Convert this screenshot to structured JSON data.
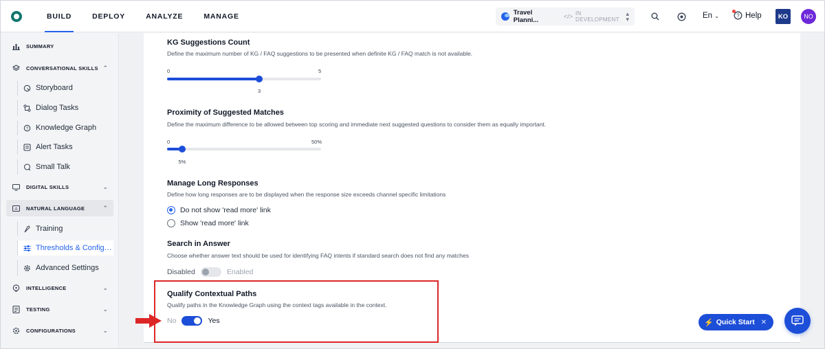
{
  "topbar": {
    "tabs": [
      "BUILD",
      "DEPLOY",
      "ANALYZE",
      "MANAGE"
    ],
    "active_tab": "BUILD",
    "app_name": "Travel Planni...",
    "app_status": "IN DEVELOPMENT",
    "language": "En",
    "help_label": "Help",
    "user_initials": "KO",
    "account_initials": "NO"
  },
  "sidebar": {
    "summary": "SUMMARY",
    "conversational_skills": "CONVERSATIONAL SKILLS",
    "conversational_items": [
      "Storyboard",
      "Dialog Tasks",
      "Knowledge Graph",
      "Alert Tasks",
      "Small Talk"
    ],
    "digital_skills": "DIGITAL SKILLS",
    "natural_language": "NATURAL LANGUAGE",
    "natural_language_items": [
      "Training",
      "Thresholds & Configu...",
      "Advanced Settings"
    ],
    "intelligence": "INTELLIGENCE",
    "testing": "TESTING",
    "configurations": "CONFIGURATIONS"
  },
  "settings": {
    "kg_count": {
      "title": "KG Suggestions Count",
      "desc": "Define the maximum number of KG / FAQ suggestions to be presented when definite KG / FAQ match is not available.",
      "min": "0",
      "max": "5",
      "value_label": "3",
      "value": 3,
      "range_max": 5
    },
    "proximity": {
      "title": "Proximity of Suggested Matches",
      "desc": "Define the maximum difference to be allowed between top scoring and immediate next suggested questions to consider them as equally important.",
      "min": "0",
      "max": "50%",
      "value_label": "5%",
      "value": 5,
      "range_max": 50
    },
    "long_responses": {
      "title": "Manage Long Responses",
      "desc": "Define how long responses are to be displayed when the response size exceeds channel specific limitations",
      "options": [
        "Do not show 'read more' link",
        "Show 'read more' link"
      ],
      "selected": 0
    },
    "search_in_answer": {
      "title": "Search in Answer",
      "desc": "Choose whether answer text should be used for identifying FAQ intents if standard search does not find any matches",
      "off_label": "Disabled",
      "on_label": "Enabled",
      "enabled": false
    },
    "qualify_paths": {
      "title": "Qualify Contextual Paths",
      "desc": "Qualify paths in the Knowledge Graph using the context tags available in the context.",
      "off_label": "No",
      "on_label": "Yes",
      "enabled": true
    }
  },
  "floating": {
    "quick_start": "Quick Start"
  },
  "colors": {
    "accent": "#1d4ed8",
    "highlight": "#dc2626"
  }
}
